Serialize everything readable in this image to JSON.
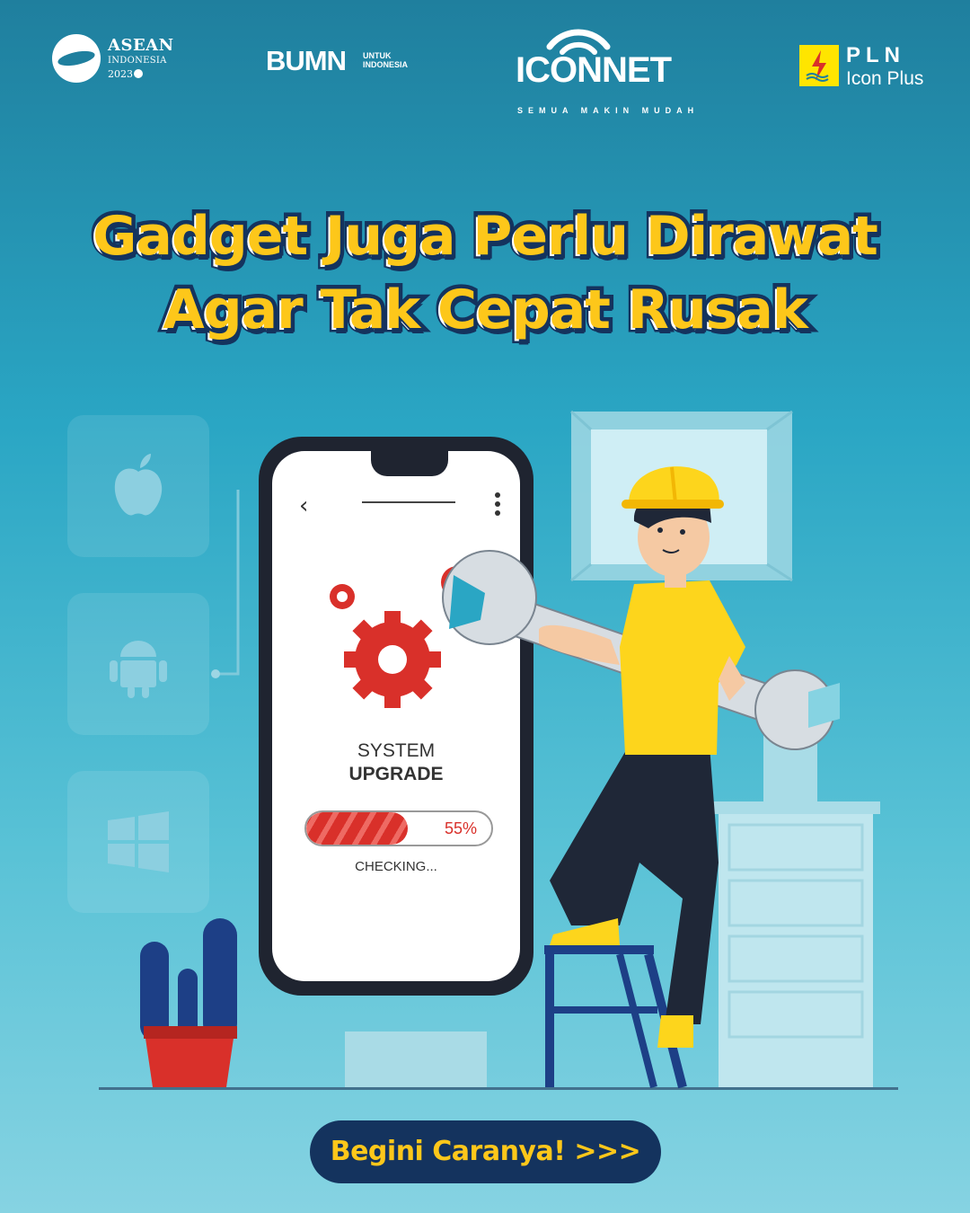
{
  "logos": {
    "asean": {
      "line1": "ASEAN",
      "line2": "INDONESIA",
      "line3": "2023"
    },
    "bumn": {
      "main": "BUMN",
      "sub": "UNTUK\nINDONESIA"
    },
    "iconnet": {
      "main": "ICONNET",
      "tagline": "SEMUA MAKIN MUDAH"
    },
    "pln": {
      "main": "PLN",
      "sub": "Icon Plus"
    }
  },
  "headline": {
    "line1": "Gadget Juga Perlu Dirawat",
    "line2": "Agar Tak Cepat Rusak"
  },
  "os_icons": [
    "apple-icon",
    "android-icon",
    "windows-icon"
  ],
  "phone_screen": {
    "title_line1": "SYSTEM",
    "title_line2": "UPGRADE",
    "progress_percent": 55,
    "progress_label": "55%",
    "status": "CHECKING..."
  },
  "cta": {
    "label": "Begini Caranya! >>>"
  },
  "colors": {
    "headline_fill": "#fdc71a",
    "headline_outline": "#14335e",
    "cta_background": "#14335e",
    "accent_red": "#d9302a",
    "worker_shirt": "#fdd51c"
  }
}
